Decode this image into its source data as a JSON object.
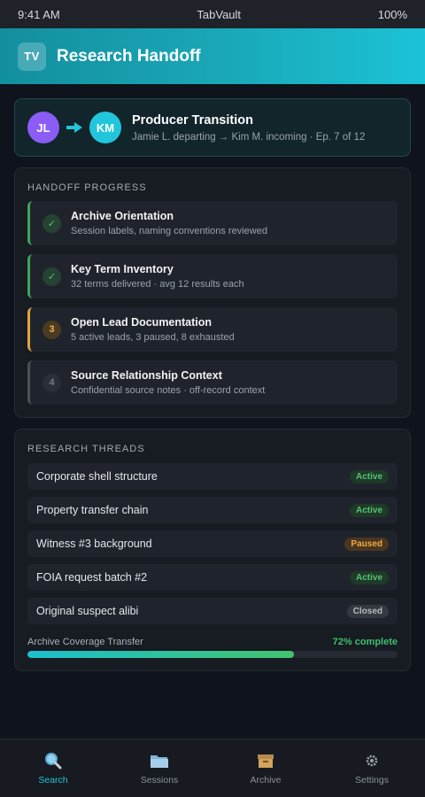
{
  "status_bar": {
    "time": "9:41 AM",
    "app_name": "TabVault",
    "battery": "100%"
  },
  "header": {
    "logo_text": "TV",
    "title": "Research Handoff"
  },
  "transition": {
    "from_initials": "JL",
    "to_initials": "KM",
    "title": "Producer Transition",
    "subtitle": "Jamie L. departing → Kim M. incoming · Ep. 7 of 12"
  },
  "progress": {
    "heading": "HANDOFF PROGRESS",
    "steps": [
      {
        "state": "done",
        "badge": "✓",
        "title": "Archive Orientation",
        "desc": "Session labels, naming conventions reviewed"
      },
      {
        "state": "done",
        "badge": "✓",
        "title": "Key Term Inventory",
        "desc": "32 terms delivered · avg 12 results each"
      },
      {
        "state": "current",
        "badge": "3",
        "title": "Open Lead Documentation",
        "desc": "5 active leads, 3 paused, 8 exhausted"
      },
      {
        "state": "pending",
        "badge": "4",
        "title": "Source Relationship Context",
        "desc": "Confidential source notes · off-record context"
      }
    ]
  },
  "threads": {
    "heading": "RESEARCH THREADS",
    "items": [
      {
        "name": "Corporate shell structure",
        "status": "Active"
      },
      {
        "name": "Property transfer chain",
        "status": "Active"
      },
      {
        "name": "Witness #3 background",
        "status": "Paused"
      },
      {
        "name": "FOIA request batch #2",
        "status": "Active"
      },
      {
        "name": "Original suspect alibi",
        "status": "Closed"
      }
    ],
    "coverage_label": "Archive Coverage Transfer",
    "coverage_text": "72% complete",
    "coverage_fraction": 0.72
  },
  "tabs": [
    {
      "label": "Search",
      "icon": "magnifier-icon",
      "selected": true
    },
    {
      "label": "Sessions",
      "icon": "folder-icon",
      "selected": false
    },
    {
      "label": "Archive",
      "icon": "archive-box-icon",
      "selected": false
    },
    {
      "label": "Settings",
      "icon": "gear-icon",
      "selected": false
    }
  ],
  "colors": {
    "accent": "#1fc1d6",
    "done": "#3fa45a",
    "current": "#e0a540",
    "avatar_from": "#8b5cf6",
    "avatar_to": "#22c6dc"
  }
}
